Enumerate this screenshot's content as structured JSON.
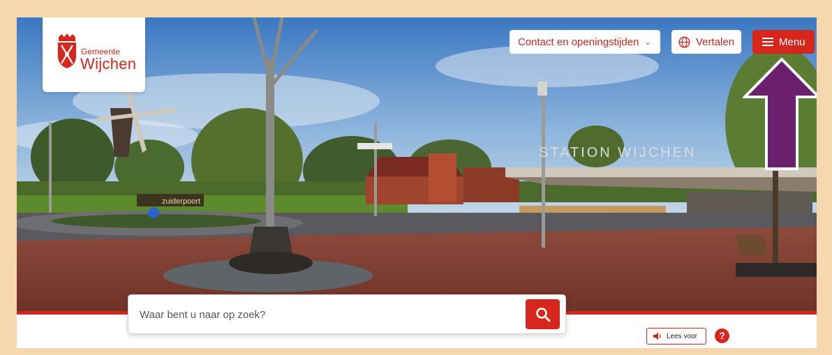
{
  "header": {
    "logo": {
      "line1": "Gemeente",
      "line2": "Wijchen"
    },
    "contact_label": "Contact en openingstijden",
    "translate_label": "Vertalen",
    "menu_label": "Menu"
  },
  "hero": {
    "signs": {
      "station": "STATION WIJCHEN",
      "roundabout": "zuiderpoort"
    }
  },
  "search": {
    "placeholder": "Waar bent u naar op zoek?"
  },
  "footer": {
    "read_aloud_label": "Lees voor",
    "help_label": "?"
  },
  "annotation": {
    "arrow_color": "#6a1f6f"
  },
  "colors": {
    "brand": "#d7261c",
    "background": "#f6d7ae"
  },
  "icons": {
    "crest": "municipal-crest-icon",
    "chevron": "chevron-down-icon",
    "globe": "globe-icon",
    "menu": "hamburger-icon",
    "search": "search-icon",
    "speaker": "speaker-icon",
    "help": "help-icon"
  }
}
